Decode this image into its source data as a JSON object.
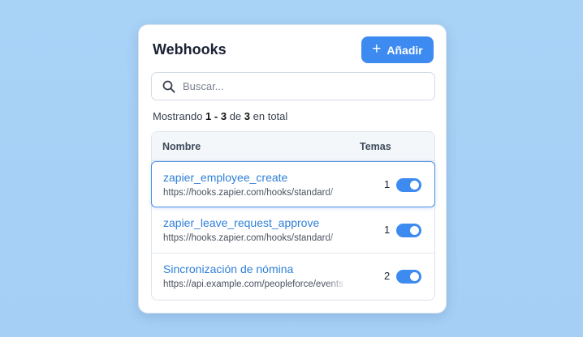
{
  "header": {
    "title": "Webhooks",
    "add_label": "Añadir"
  },
  "search": {
    "placeholder": "Buscar..."
  },
  "summary": {
    "prefix": "Mostrando",
    "range": "1 - 3",
    "of": "de",
    "total": "3",
    "suffix": "en total"
  },
  "table": {
    "columns": {
      "name": "Nombre",
      "topics": "Temas"
    },
    "rows": [
      {
        "name": "zapier_employee_create",
        "url": "https://hooks.zapier.com/hooks/standard/",
        "topics": "1",
        "enabled": true,
        "selected": true
      },
      {
        "name": "zapier_leave_request_approve",
        "url": "https://hooks.zapier.com/hooks/standard/",
        "topics": "1",
        "enabled": true,
        "selected": false
      },
      {
        "name": "Sincronización de nómina",
        "url": "https://api.example.com/peopleforce/events",
        "topics": "2",
        "enabled": true,
        "selected": false
      }
    ]
  },
  "colors": {
    "accent": "#3d8bf0",
    "link": "#2f7fd8",
    "background": "#a9d2f7"
  }
}
